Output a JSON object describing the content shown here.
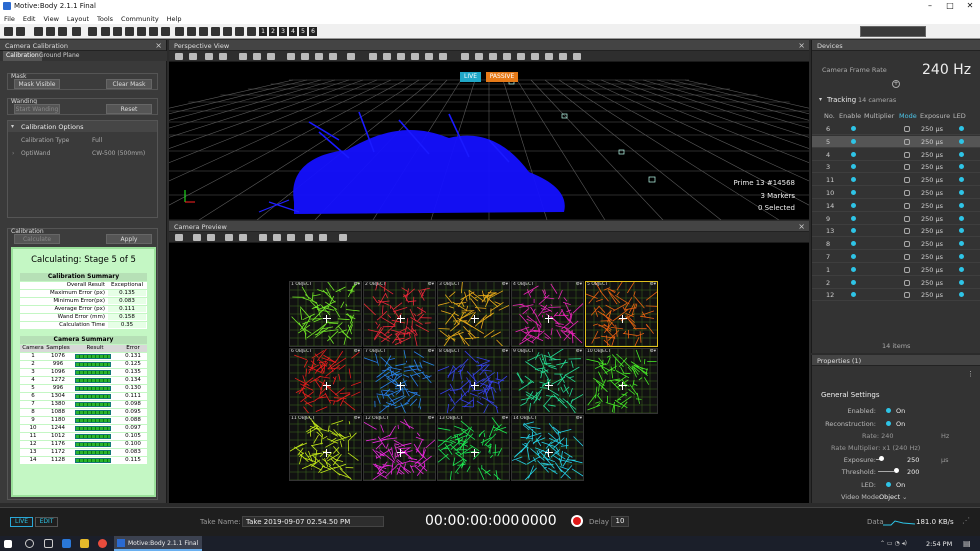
{
  "title": "Motive:Body 2.1.1 Final",
  "menu": [
    "File",
    "Edit",
    "View",
    "Layout",
    "Tools",
    "Community",
    "Help"
  ],
  "toolbar_numbers": [
    "1",
    "2",
    "3",
    "4",
    "5",
    "6"
  ],
  "calibration": {
    "panel_title": "Camera Calibration",
    "tabs": [
      "Calibration",
      "Ground Plane"
    ],
    "mask_label": "Mask",
    "mask_visible": "Mask Visible",
    "clear_mask": "Clear Mask",
    "wanding_label": "Wanding",
    "start_wanding": "Start Wanding",
    "reset": "Reset",
    "options_label": "Calibration Options",
    "type_label": "Calibration Type",
    "type_value": "Full",
    "optiwand_label": "OptiWand",
    "optiwand_value": "CW-500 (500mm)",
    "calib_label": "Calibration",
    "calculate": "Calculate",
    "apply": "Apply",
    "stage": "Calculating: Stage 5 of 5",
    "summary_title": "Calibration Summary",
    "summary": [
      {
        "k": "Overall Result",
        "v": "Exceptional"
      },
      {
        "k": "Maximum Error (px)",
        "v": "0.135"
      },
      {
        "k": "Minimum Error(px)",
        "v": "0.083"
      },
      {
        "k": "Average Error (px)",
        "v": "0.111"
      },
      {
        "k": "Wand Error (mm)",
        "v": "0.158"
      },
      {
        "k": "Calculation Time",
        "v": "0.35"
      }
    ],
    "camera_summary_title": "Camera Summary",
    "cam_headers": [
      "Camera",
      "Samples",
      "Result",
      "Error"
    ],
    "cameras": [
      {
        "c": "1",
        "s": "1076",
        "e": "0.131"
      },
      {
        "c": "2",
        "s": "996",
        "e": "0.125"
      },
      {
        "c": "3",
        "s": "1096",
        "e": "0.135"
      },
      {
        "c": "4",
        "s": "1272",
        "e": "0.134"
      },
      {
        "c": "5",
        "s": "996",
        "e": "0.130"
      },
      {
        "c": "6",
        "s": "1304",
        "e": "0.111"
      },
      {
        "c": "7",
        "s": "1380",
        "e": "0.098"
      },
      {
        "c": "8",
        "s": "1088",
        "e": "0.095"
      },
      {
        "c": "9",
        "s": "1180",
        "e": "0.088"
      },
      {
        "c": "10",
        "s": "1244",
        "e": "0.097"
      },
      {
        "c": "11",
        "s": "1012",
        "e": "0.105"
      },
      {
        "c": "12",
        "s": "1176",
        "e": "0.100"
      },
      {
        "c": "13",
        "s": "1172",
        "e": "0.083"
      },
      {
        "c": "14",
        "s": "1128",
        "e": "0.115"
      }
    ]
  },
  "perspective": {
    "title": "Perspective View",
    "live": "LIVE",
    "passive": "PASSIVE",
    "camera_name": "Prime 13 #14568",
    "markers": "3 Markers",
    "selected": "0 Selected"
  },
  "preview": {
    "title": "Camera Preview",
    "object_label": "OBJECT",
    "cells": [
      {
        "n": "1",
        "color": "#7cff2a"
      },
      {
        "n": "2",
        "color": "#ff2a3c"
      },
      {
        "n": "3",
        "color": "#ffbb1a"
      },
      {
        "n": "4",
        "color": "#ff26c8"
      },
      {
        "n": "5",
        "color": "#ff6a12"
      },
      {
        "n": "6",
        "color": "#ff1e1e"
      },
      {
        "n": "7",
        "color": "#2a8cff"
      },
      {
        "n": "8",
        "color": "#3a46ff"
      },
      {
        "n": "9",
        "color": "#27f0a0"
      },
      {
        "n": "10",
        "color": "#4cff2a"
      },
      {
        "n": "11",
        "color": "#d6ff1a"
      },
      {
        "n": "12",
        "color": "#ff2af0"
      },
      {
        "n": "13",
        "color": "#1eff5a"
      },
      {
        "n": "14",
        "color": "#27e6ff"
      }
    ]
  },
  "devices": {
    "title": "Devices",
    "frame_rate_label": "Camera Frame Rate",
    "frame_rate": "240 Hz",
    "tracking_label": "Tracking",
    "tracking_count": "14 cameras",
    "headers": [
      "No.",
      "Enable",
      "Multiplier",
      "Mode",
      "Exposure",
      "LED"
    ],
    "rows": [
      {
        "no": "6",
        "exp": "250 µs"
      },
      {
        "no": "5",
        "exp": "250 µs",
        "sel": true
      },
      {
        "no": "4",
        "exp": "250 µs"
      },
      {
        "no": "3",
        "exp": "250 µs"
      },
      {
        "no": "11",
        "exp": "250 µs"
      },
      {
        "no": "10",
        "exp": "250 µs"
      },
      {
        "no": "14",
        "exp": "250 µs"
      },
      {
        "no": "9",
        "exp": "250 µs"
      },
      {
        "no": "13",
        "exp": "250 µs"
      },
      {
        "no": "8",
        "exp": "250 µs"
      },
      {
        "no": "7",
        "exp": "250 µs"
      },
      {
        "no": "1",
        "exp": "250 µs"
      },
      {
        "no": "2",
        "exp": "250 µs"
      },
      {
        "no": "12",
        "exp": "250 µs"
      }
    ],
    "items": "14 items"
  },
  "properties": {
    "title": "Properties (1)",
    "section": "General Settings",
    "enabled_label": "Enabled:",
    "enabled": "On",
    "reconstruction_label": "Reconstruction:",
    "reconstruction": "On",
    "rate_label": "Rate: 240",
    "rate_unit": "Hz",
    "multiplier": "Rate Multiplier: x1 (240 Hz)",
    "exposure_label": "Exposure:",
    "exposure": "250",
    "exposure_unit": "µs",
    "threshold_label": "Threshold:",
    "threshold": "200",
    "led_label": "LED:",
    "led": "On",
    "video_mode_label": "Video Mode:",
    "video_mode": "Object"
  },
  "bottom": {
    "live": "LIVE",
    "edit": "EDIT",
    "take_label": "Take Name:",
    "take_name": "Take 2019-09-07 02.54.50 PM",
    "timecode": "00:00:00:000",
    "frames": "0000",
    "delay_label": "Delay",
    "delay": "10",
    "data_label": "Data",
    "data_rate": "181.0 KB/s"
  },
  "taskbar": {
    "app": "Motive:Body 2.1.1 Final",
    "time": "2:54 PM"
  }
}
